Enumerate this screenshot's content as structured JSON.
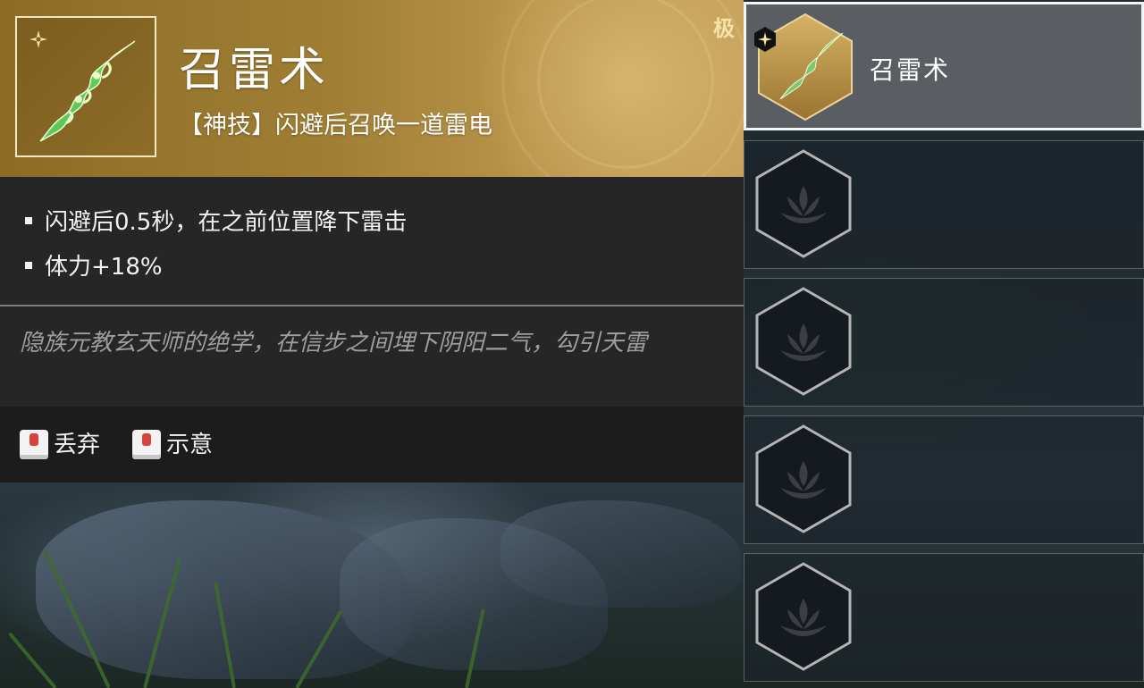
{
  "detail": {
    "grade": "极",
    "title": "召雷术",
    "subtitle": "【神技】闪避后召唤一道雷电",
    "stats": [
      "闪避后0.5秒，在之前位置降下雷击",
      "体力+18%"
    ],
    "lore": "隐族元教玄天师的绝学，在信步之间埋下阴阳二气，勾引天雷"
  },
  "actions": [
    {
      "label": "丢弃",
      "icon": "keyboard-key-icon"
    },
    {
      "label": "示意",
      "icon": "keyboard-key-icon"
    }
  ],
  "slots": [
    {
      "name": "召雷术",
      "selected": true,
      "icon": "jade-thunder-talisman-icon"
    },
    {
      "name": "",
      "selected": false,
      "icon": "lotus-emblem-icon"
    },
    {
      "name": "",
      "selected": false,
      "icon": "lotus-emblem-icon"
    },
    {
      "name": "",
      "selected": false,
      "icon": "lotus-emblem-icon"
    },
    {
      "name": "",
      "selected": false,
      "icon": "lotus-emblem-icon"
    }
  ],
  "colors": {
    "gold_header": "#a58338",
    "panel_dark": "#262626",
    "action_bar": "#1c1c1c",
    "key_red": "#d9413a",
    "lore_text": "#9e9e9e"
  }
}
